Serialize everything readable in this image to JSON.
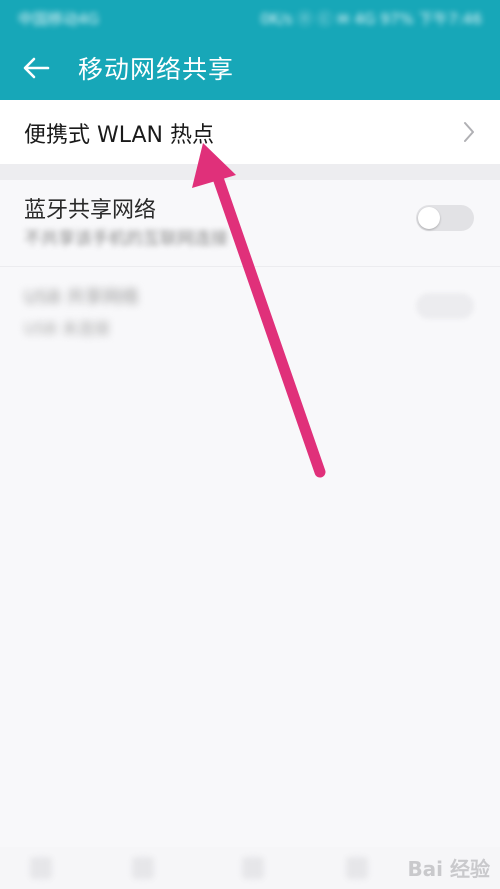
{
  "statusbar": {
    "left_text": "中国移动4G",
    "right_text": "0K/s ⓝ ⓒ ✉ 4G 97% 下午7:46"
  },
  "header": {
    "title": "移动网络共享",
    "back_icon": "back-arrow-icon"
  },
  "wlan_row": {
    "label": "便携式 WLAN 热点",
    "chevron_icon": "chevron-right-icon"
  },
  "bluetooth_row": {
    "label": "蓝牙共享网络",
    "subtitle": "不共享该手机的互联网连接",
    "toggle_on": false
  },
  "usb_row": {
    "label": "USB 共享网络",
    "subtitle": "USB 未连接",
    "toggle_on": false
  },
  "watermark": {
    "text": "Bai 经验"
  },
  "annotation": {
    "arrow_color": "#e0307a"
  },
  "colors": {
    "accent": "#17a7b8"
  }
}
